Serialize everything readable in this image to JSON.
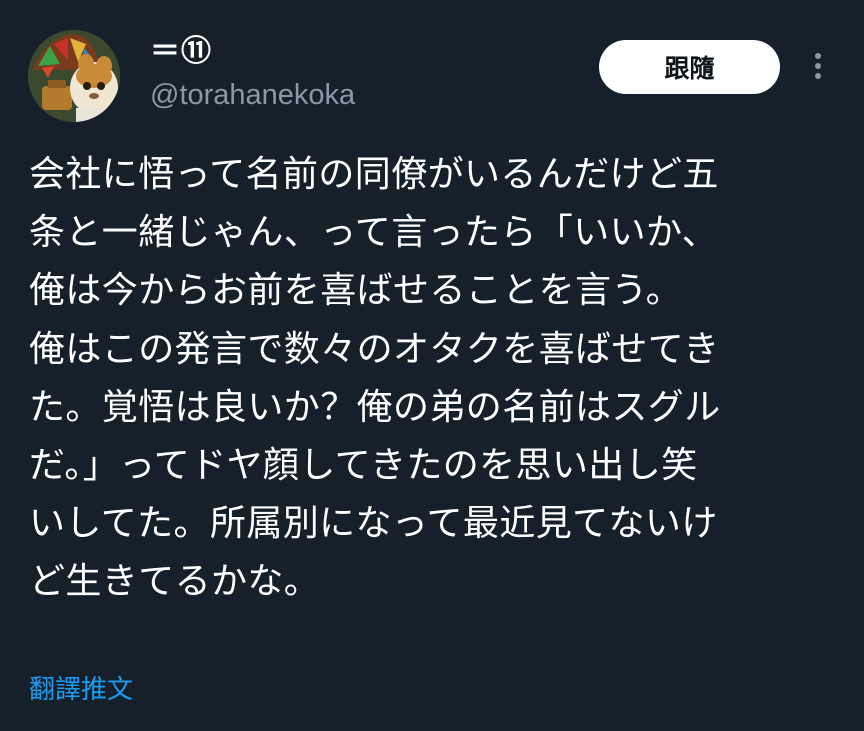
{
  "user": {
    "display_name": "＝⑪",
    "handle": "@torahanekoka"
  },
  "follow_button": {
    "label": "跟隨"
  },
  "more_button": {
    "icon": "more-vertical-icon"
  },
  "tweet": {
    "text": "会社に悟って名前の同僚がいるんだけど五\n条と一緒じゃん、って言ったら「いいか、\n俺は今からお前を喜ばせることを言う。\n俺はこの発言で数々のオタクを喜ばせてき\nた。覚悟は良いか？俺の弟の名前はスグル\nだ。」ってドヤ顔してきたのを思い出し笑\nいしてた。所属別になって最近見てないけ\nど生きてるかな。"
  },
  "translate": {
    "label": "翻譯推文"
  },
  "colors": {
    "background": "#15202b",
    "text_primary": "#ffffff",
    "text_secondary": "#8b98a5",
    "accent": "#1d9bf0",
    "button_bg": "#ffffff",
    "button_text": "#0f1419"
  }
}
